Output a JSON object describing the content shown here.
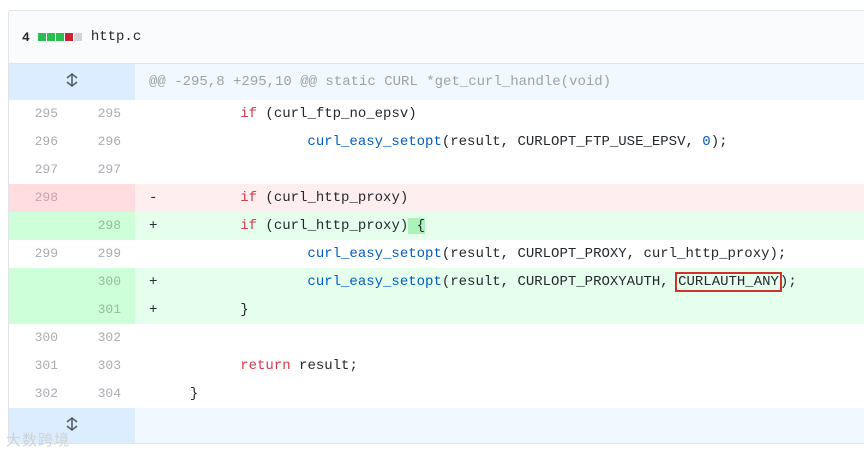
{
  "file": {
    "change_count": "4",
    "filename": "http.c",
    "stat_blocks": [
      "add",
      "add",
      "add",
      "del",
      "neu"
    ]
  },
  "hunk": {
    "header": "@@ -295,8 +295,10 @@ static CURL *get_curl_handle(void)"
  },
  "lines": [
    {
      "type": "ctx",
      "old": "295",
      "new": "295",
      "marker": "",
      "indent": "        ",
      "tokens": [
        {
          "t": "if",
          "c": "kw"
        },
        {
          "t": " (curl_ftp_no_epsv)"
        }
      ]
    },
    {
      "type": "ctx",
      "old": "296",
      "new": "296",
      "marker": "",
      "indent": "                ",
      "tokens": [
        {
          "t": "curl_easy_setopt",
          "c": "fn"
        },
        {
          "t": "(result, CURLOPT_FTP_USE_EPSV, "
        },
        {
          "t": "0",
          "c": "fn"
        },
        {
          "t": ");"
        }
      ]
    },
    {
      "type": "ctx",
      "old": "297",
      "new": "297",
      "marker": "",
      "indent": "",
      "tokens": []
    },
    {
      "type": "del",
      "old": "298",
      "new": "",
      "marker": "-",
      "indent": "        ",
      "tokens": [
        {
          "t": "if",
          "c": "kw"
        },
        {
          "t": " (curl_http_proxy)"
        }
      ]
    },
    {
      "type": "add",
      "old": "",
      "new": "298",
      "marker": "+",
      "indent": "        ",
      "tokens": [
        {
          "t": "if",
          "c": "kw"
        },
        {
          "t": " (curl_http_proxy)"
        },
        {
          "t": " {",
          "c": "hl"
        }
      ]
    },
    {
      "type": "ctx",
      "old": "299",
      "new": "299",
      "marker": "",
      "indent": "                ",
      "tokens": [
        {
          "t": "curl_easy_setopt",
          "c": "fn"
        },
        {
          "t": "(result, CURLOPT_PROXY, curl_http_proxy);"
        }
      ]
    },
    {
      "type": "add",
      "old": "",
      "new": "300",
      "marker": "+",
      "indent": "                ",
      "tokens": [
        {
          "t": "curl_easy_setopt",
          "c": "fn"
        },
        {
          "t": "(result, CURLOPT_PROXYAUTH, "
        },
        {
          "t": "CURLAUTH_ANY",
          "c": "boxed"
        },
        {
          "t": ");"
        }
      ]
    },
    {
      "type": "add",
      "old": "",
      "new": "301",
      "marker": "+",
      "indent": "        ",
      "tokens": [
        {
          "t": "}"
        }
      ]
    },
    {
      "type": "ctx",
      "old": "300",
      "new": "302",
      "marker": "",
      "indent": "",
      "tokens": []
    },
    {
      "type": "ctx",
      "old": "301",
      "new": "303",
      "marker": "",
      "indent": "        ",
      "tokens": [
        {
          "t": "return",
          "c": "kw"
        },
        {
          "t": " result;"
        }
      ]
    },
    {
      "type": "ctx",
      "old": "302",
      "new": "304",
      "marker": "",
      "indent": "  ",
      "tokens": [
        {
          "t": "}"
        }
      ]
    }
  ],
  "watermark": "大数跨境",
  "colors": {
    "addition": "#2cbe4e",
    "deletion": "#cb2431",
    "keyword": "#d73a49",
    "function": "#005cc5",
    "highlight_box": "#d0312d"
  },
  "icons": {
    "expand_up": "unfold-icon",
    "expand_down": "unfold-icon"
  }
}
